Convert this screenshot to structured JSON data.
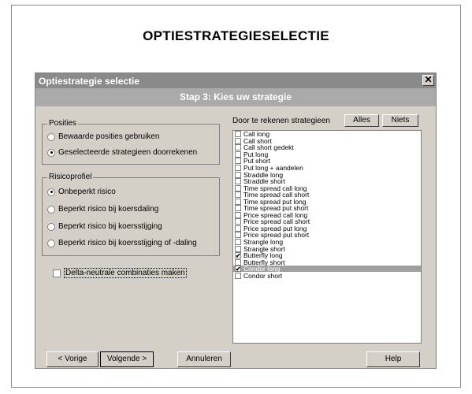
{
  "page_title": "OPTIESTRATEGIESELECTIE",
  "dialog": {
    "title": "Optiestrategie selectie",
    "close_glyph": "✕",
    "step_title": "Stap 3: Kies uw strategie"
  },
  "posities": {
    "legend": "Posities",
    "options": [
      {
        "label": "Bewaarde posities gebruiken",
        "selected": false
      },
      {
        "label": "Geselecteerde strategieen doorrekenen",
        "selected": true
      }
    ]
  },
  "risicoprofiel": {
    "legend": "Risicoprofiel",
    "options": [
      {
        "label": "Onbeperkt risico",
        "selected": true
      },
      {
        "label": "Beperkt risico bij koersdaling",
        "selected": false
      },
      {
        "label": "Beperkt risico bij koersstijging",
        "selected": false
      },
      {
        "label": "Beperkt risico bij koersstijging of -daling",
        "selected": false
      }
    ]
  },
  "delta_neutral": {
    "label": "Delta-neutrale combinaties maken",
    "checked": false
  },
  "strategies": {
    "label": "Door te rekenen strategieen",
    "all_button": "Alles",
    "none_button": "Niets",
    "items": [
      {
        "label": "Call long",
        "checked": false,
        "selected": false
      },
      {
        "label": "Call short",
        "checked": false,
        "selected": false
      },
      {
        "label": "Call short gedekt",
        "checked": false,
        "selected": false
      },
      {
        "label": "Put long",
        "checked": false,
        "selected": false
      },
      {
        "label": "Put short",
        "checked": false,
        "selected": false
      },
      {
        "label": "Put long + aandelen",
        "checked": false,
        "selected": false
      },
      {
        "label": "Straddle long",
        "checked": false,
        "selected": false
      },
      {
        "label": "Straddle short",
        "checked": false,
        "selected": false
      },
      {
        "label": "Time spread call long",
        "checked": false,
        "selected": false
      },
      {
        "label": "Time spread call short",
        "checked": false,
        "selected": false
      },
      {
        "label": "Time spread put long",
        "checked": false,
        "selected": false
      },
      {
        "label": "Time spread put short",
        "checked": false,
        "selected": false
      },
      {
        "label": "Price spread call long",
        "checked": false,
        "selected": false
      },
      {
        "label": "Price spread call short",
        "checked": false,
        "selected": false
      },
      {
        "label": "Price spread put long",
        "checked": false,
        "selected": false
      },
      {
        "label": "Price spread put short",
        "checked": false,
        "selected": false
      },
      {
        "label": "Strangle long",
        "checked": false,
        "selected": false
      },
      {
        "label": "Strangle short",
        "checked": false,
        "selected": false
      },
      {
        "label": "Butterfly long",
        "checked": true,
        "selected": false
      },
      {
        "label": "Butterfly short",
        "checked": false,
        "selected": false
      },
      {
        "label": "Condor long",
        "checked": true,
        "selected": true
      },
      {
        "label": "Condor short",
        "checked": false,
        "selected": false
      }
    ]
  },
  "footer": {
    "back": "< Vorige",
    "next": "Volgende >",
    "cancel": "Annuleren",
    "help": "Help"
  },
  "colors": {
    "dialog_face": "#d4d0c8",
    "title_bar": "#8a8a8a",
    "step_bar": "#aaaaaa",
    "selection": "#a0a0a0"
  }
}
